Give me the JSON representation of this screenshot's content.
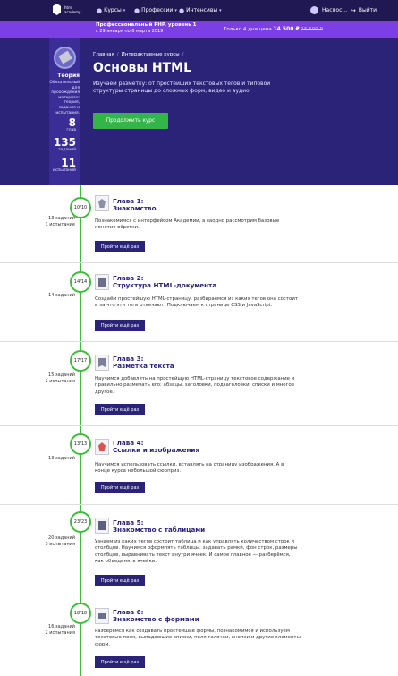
{
  "header": {
    "logo_text": "html academy",
    "nav": [
      {
        "label": "Курсы"
      },
      {
        "label": "Профессии"
      },
      {
        "label": "Интенсивы"
      }
    ],
    "user_name": "Наспос...",
    "logout": "Выйти"
  },
  "promo": {
    "title": "Профессиональный PHP, уровень 1",
    "date": "с 29 января по 6 марта 2019",
    "price_prefix": "Только 4 дня цена",
    "price": "14 500 ₽",
    "old_price": "16 500 ₽"
  },
  "theory": {
    "title": "Теория",
    "desc": "Обязательный для прохождения материал: теория, задания и испытания.",
    "stats": [
      {
        "num": "8",
        "label": "глав"
      },
      {
        "num": "135",
        "label": "заданий"
      },
      {
        "num": "11",
        "label": "испытаний"
      }
    ]
  },
  "hero": {
    "breadcrumb": [
      "Главная",
      "Интерактивные курсы"
    ],
    "title": "Основы HTML",
    "desc": "Изучаем разметку: от простейших текстовых тегов и типовой структуры страницы до сложных форм, видео и аудио.",
    "cta": "Продолжить курс"
  },
  "chapters": [
    {
      "progress": "10/10",
      "count1": "13 заданий",
      "count2": "1 испытание",
      "title1": "Глава 1:",
      "title2": "Знакомство",
      "desc": "Познакомимся с интерфейсом Академии, а заодно рассмотрим базовые понятия вёрстки.",
      "button": "Пройти ещё раз",
      "icon_color": "#8b8fa8"
    },
    {
      "progress": "14/14",
      "count1": "14 заданий",
      "count2": "",
      "title1": "Глава 2:",
      "title2": "Структура HTML-документа",
      "desc": "Создаём простейшую HTML-страницу, разбираемся из каких тегов она состоит и за что эти теги отвечают. Подключаем к странице CSS и JavaScript.",
      "button": "Пройти ещё раз",
      "icon_color": "#6a6e8c"
    },
    {
      "progress": "17/17",
      "count1": "15 заданий",
      "count2": "2 испытания",
      "title1": "Глава 3:",
      "title2": "Разметка текста",
      "desc": "Научимся добавлять на простейшую HTML-страницу текстовое содержание и правильно размечать его: абзацы, заголовки, подзаголовки, списки и многое другое.",
      "button": "Пройти ещё раз",
      "icon_color": "#7c809c"
    },
    {
      "progress": "13/13",
      "count1": "13 заданий",
      "count2": "",
      "title1": "Глава 4:",
      "title2": "Ссылки и изображения",
      "desc": "Научимся использовать ссылки, вставлять на страницу изображения. А в конце курса небольшой сюрприз.",
      "button": "Пройти ещё раз",
      "icon_color": "#d9534f"
    },
    {
      "progress": "23/23",
      "count1": "20 заданий",
      "count2": "3 испытания",
      "title1": "Глава 5:",
      "title2": "Знакомство с таблицами",
      "desc": "Узнаем из каких тегов состоит таблица и как управлять количеством строк и столбцов. Научимся оформлять таблицы: задавать рамки, фон строк, размеры столбцов, выравнивать текст внутри ячеек. И самое главное — разберёмся, как объединять ячейки.",
      "button": "Пройти ещё раз",
      "icon_color": "#5c6080"
    },
    {
      "progress": "18/18",
      "count1": "16 заданий",
      "count2": "2 испытания",
      "title1": "Глава 6:",
      "title2": "Знакомство с формами",
      "desc": "Разберёмся как создавать простейшие формы, познакомимся и используем текстовые поля, выпадающие списки, поля-галочки, кнопки и другие элементы форм.",
      "button": "Пройти ещё раз",
      "icon_color": "#6a6e8c"
    }
  ]
}
